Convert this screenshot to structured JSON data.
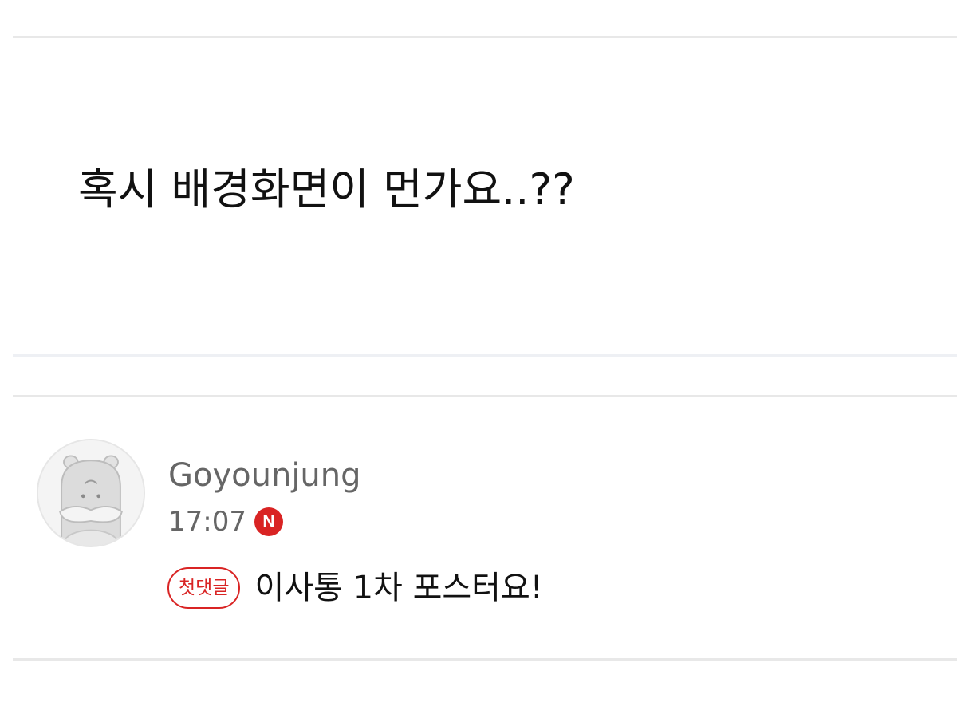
{
  "post": {
    "body": "혹시 배경화면이 먼가요..??"
  },
  "comment": {
    "author": "Goyounjung",
    "time": "17:07",
    "new_badge": "N",
    "first_badge": "첫댓글",
    "text": "이사통 1차 포스터요!",
    "avatar_icon": "hamster-avatar-icon"
  },
  "colors": {
    "accent": "#d92424",
    "text": "#111111",
    "meta": "#666666",
    "divider": "#e8e8e8"
  }
}
